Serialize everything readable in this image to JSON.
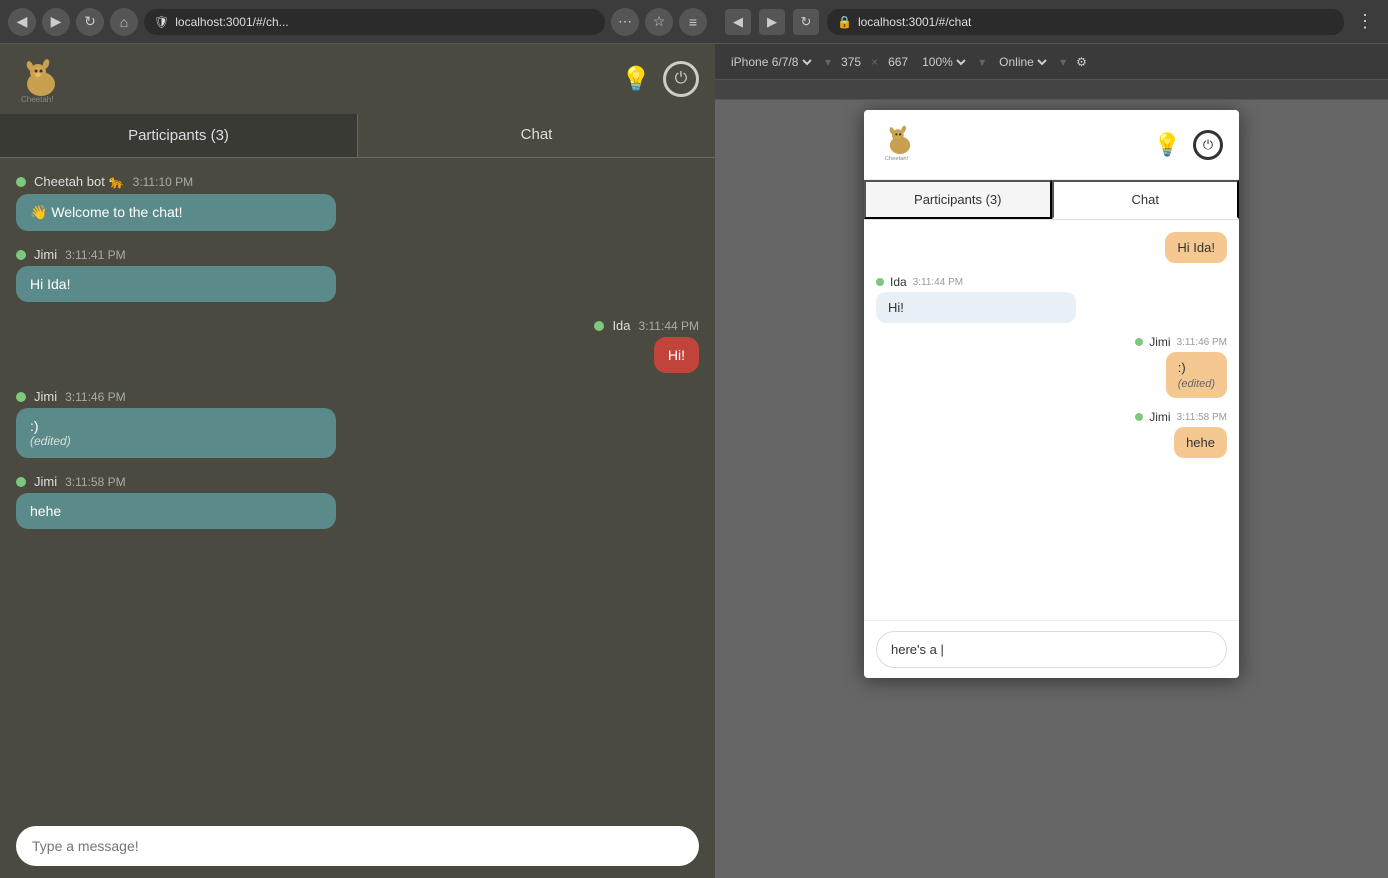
{
  "browser": {
    "url": "localhost:3001/#/ch...",
    "url_full": "localhost:3001/#/chat",
    "back_btn": "◀",
    "forward_btn": "▶",
    "refresh_btn": "↻",
    "home_btn": "⌂",
    "more_btn": "…"
  },
  "app": {
    "title": "Cheetah!",
    "tabs": {
      "participants": "Participants (3)",
      "chat": "Chat"
    },
    "messages": [
      {
        "sender": "Cheetah bot 🐆",
        "time": "3:11:10 PM",
        "text": "👋 Welcome to the chat!",
        "type": "bot",
        "align": "left"
      },
      {
        "sender": "Jimi",
        "time": "3:11:41 PM",
        "text": "Hi Ida!",
        "type": "jimi",
        "align": "left"
      },
      {
        "sender": "Ida",
        "time": "3:11:44 PM",
        "text": "Hi!",
        "type": "ida",
        "align": "right"
      },
      {
        "sender": "Jimi",
        "time": "3:11:46 PM",
        "text": ":)",
        "edited": "(edited)",
        "type": "jimi",
        "align": "left"
      },
      {
        "sender": "Jimi",
        "time": "3:11:58 PM",
        "text": "hehe",
        "type": "jimi",
        "align": "left"
      }
    ],
    "input_placeholder": "Type a message!"
  },
  "devtools": {
    "url": "localhost:3001/#/chat",
    "device": "iPhone 6/7/8",
    "width": "375",
    "height": "667",
    "zoom": "100%",
    "connection": "Online",
    "more": "⋮"
  },
  "phone": {
    "tabs": {
      "participants": "Participants (3)",
      "chat": "Chat"
    },
    "messages": [
      {
        "sender": "",
        "time": "",
        "text": "Hi Ida!",
        "type": "out",
        "align": "right"
      },
      {
        "sender": "Ida",
        "time": "3:11:44 PM",
        "text": "Hi!",
        "type": "in",
        "align": "left"
      },
      {
        "sender": "Jimi",
        "time": "3:11:46 PM",
        "text": ":)",
        "edited": "(edited)",
        "type": "out",
        "align": "right"
      },
      {
        "sender": "Jimi",
        "time": "3:11:58 PM",
        "text": "hehe",
        "type": "out",
        "align": "right"
      }
    ],
    "input_value": "here's a |"
  },
  "icons": {
    "bulb": "💡",
    "power": "⏻",
    "back": "◀",
    "forward": "▶",
    "refresh": "↻",
    "home": "⌂",
    "shield": "🛡",
    "bookmark": "☆"
  }
}
